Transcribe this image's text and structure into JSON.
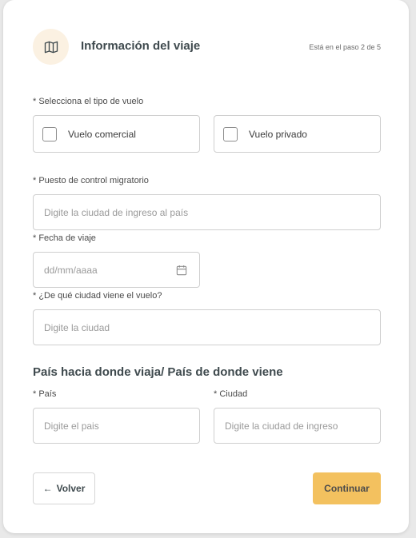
{
  "header": {
    "title": "Información del viaje",
    "step_text": "Está en el paso 2 de 5",
    "icon": "map-icon"
  },
  "flight_type": {
    "label": "* Selecciona el tipo de vuelo",
    "options": [
      {
        "label": "Vuelo comercial",
        "checked": false
      },
      {
        "label": "Vuelo privado",
        "checked": false
      }
    ]
  },
  "control_post": {
    "label": "* Puesto de control migratorio",
    "placeholder": "Digite la ciudad de ingreso al país",
    "value": ""
  },
  "travel_date": {
    "label": "* Fecha de viaje",
    "placeholder": "dd/mm/aaaa",
    "value": "",
    "icon": "calendar-icon"
  },
  "origin_city": {
    "label": "* ¿De qué ciudad viene el vuelo?",
    "placeholder": "Digite la ciudad",
    "value": ""
  },
  "destination_section": {
    "title": "País hacia donde viaja/ País de donde viene",
    "country": {
      "label": "* País",
      "placeholder": "Digite el pais",
      "value": ""
    },
    "city": {
      "label": "* Ciudad",
      "placeholder": "Digite la ciudad de ingreso",
      "value": ""
    }
  },
  "actions": {
    "back_label": "Volver",
    "continue_label": "Continuar"
  },
  "colors": {
    "accent": "#f3c15f",
    "icon_bg": "#fbf1e2",
    "title": "#3f4a4e",
    "border": "#cfcfcf"
  }
}
